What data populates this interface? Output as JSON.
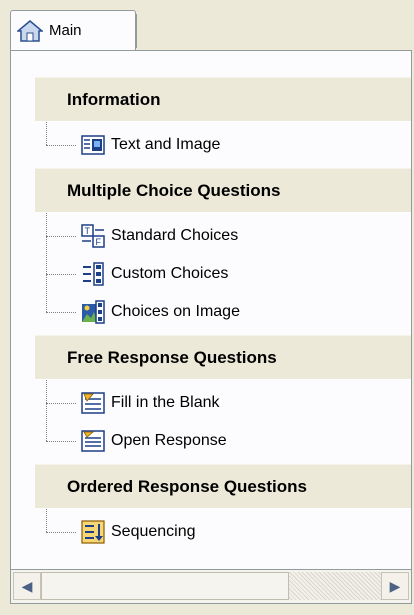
{
  "tab": {
    "label": "Main",
    "icon": "home-icon"
  },
  "sections": [
    {
      "title": "Information",
      "items": [
        {
          "label": "Text and Image",
          "icon": "text-image-icon"
        }
      ]
    },
    {
      "title": "Multiple Choice Questions",
      "items": [
        {
          "label": "Standard Choices",
          "icon": "true-false-icon"
        },
        {
          "label": "Custom Choices",
          "icon": "custom-choices-icon"
        },
        {
          "label": "Choices on Image",
          "icon": "image-choices-icon"
        }
      ]
    },
    {
      "title": "Free Response Questions",
      "items": [
        {
          "label": "Fill in the Blank",
          "icon": "fill-blank-icon"
        },
        {
          "label": "Open Response",
          "icon": "open-response-icon"
        }
      ]
    },
    {
      "title": "Ordered Response Questions",
      "items": [
        {
          "label": "Sequencing",
          "icon": "sequencing-icon"
        }
      ]
    }
  ],
  "scrollbar": {
    "left_arrow": "◀",
    "right_arrow": "▶",
    "position_fraction": 0.0
  },
  "colors": {
    "header_bg": "#ece9d8",
    "panel_bg": "#fcfcfe",
    "border": "#919b9c"
  }
}
